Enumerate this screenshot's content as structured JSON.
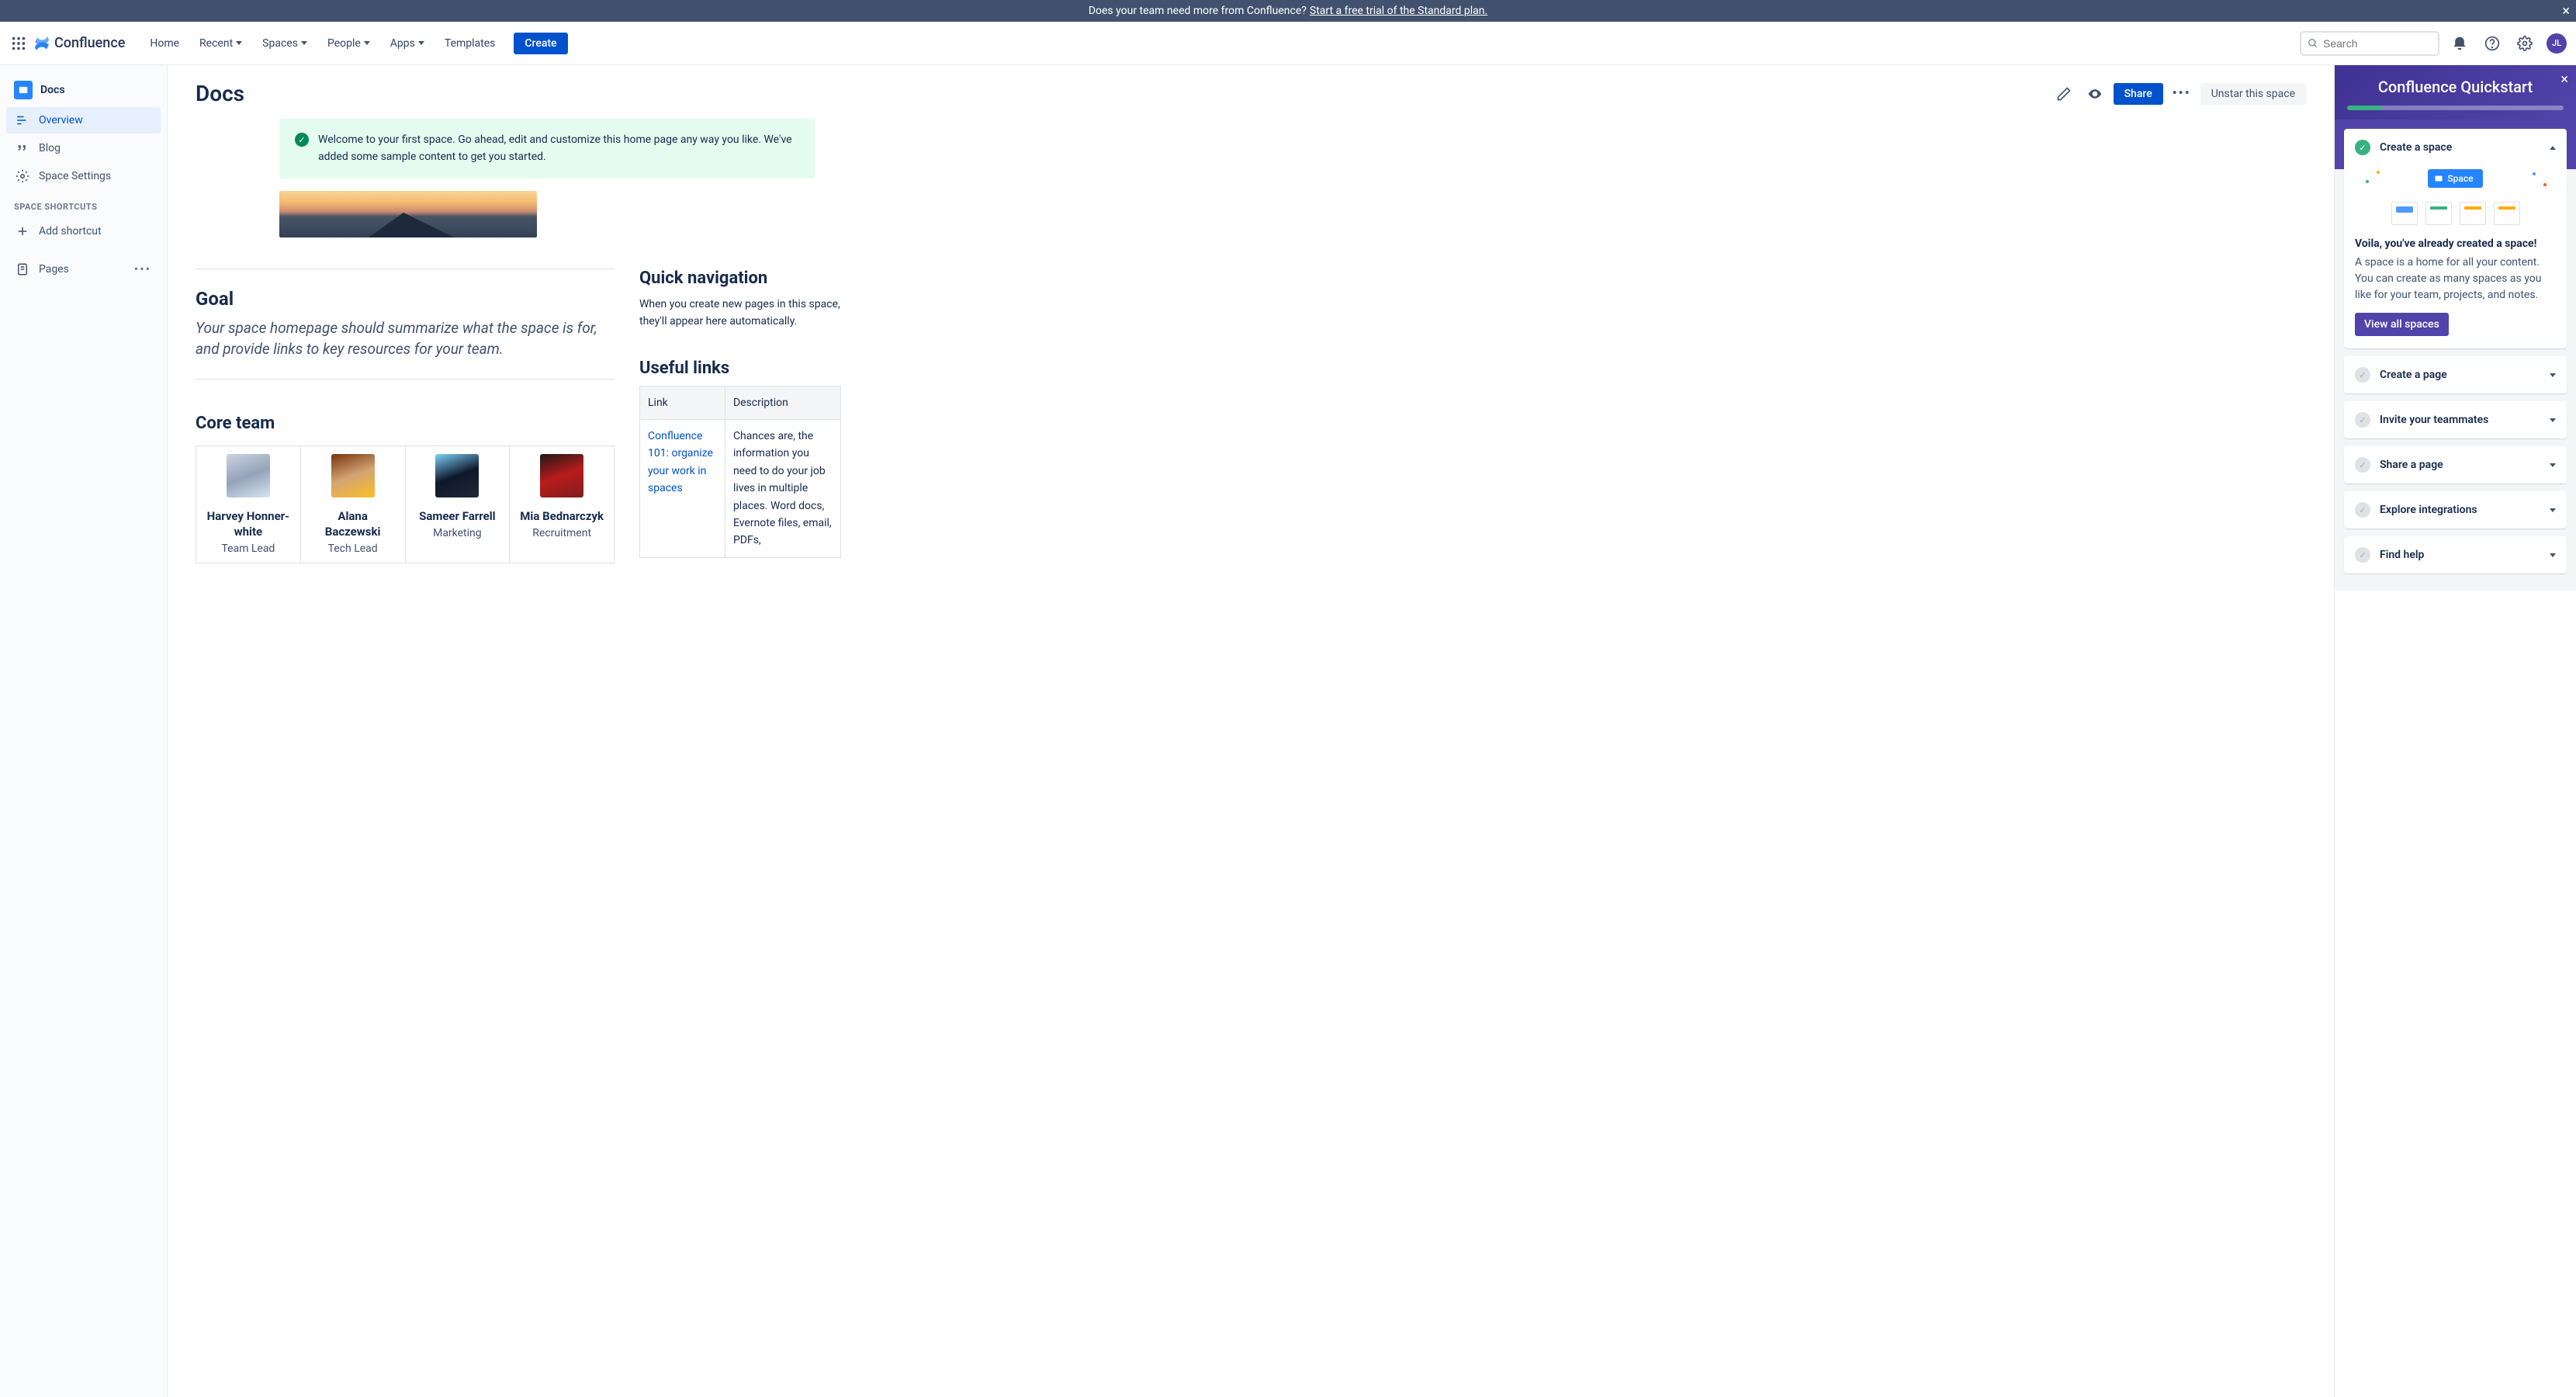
{
  "banner": {
    "text": "Does your team need more from Confluence?",
    "link": "Start a free trial of the Standard plan."
  },
  "header": {
    "product": "Confluence",
    "nav": [
      "Home",
      "Recent",
      "Spaces",
      "People",
      "Apps",
      "Templates"
    ],
    "create": "Create",
    "search_placeholder": "Search",
    "avatar": "JL"
  },
  "sidebar": {
    "space": "Docs",
    "items": [
      {
        "label": "Overview",
        "icon": "overview"
      },
      {
        "label": "Blog",
        "icon": "blog"
      },
      {
        "label": "Space Settings",
        "icon": "settings"
      }
    ],
    "shortcuts_header": "SPACE SHORTCUTS",
    "add_shortcut": "Add shortcut",
    "pages": "Pages"
  },
  "page": {
    "title": "Docs",
    "share": "Share",
    "unstar": "Unstar this space",
    "welcome": "Welcome to your first space. Go ahead, edit and customize this home page any way you like. We've added some sample content to get you started.",
    "goal_heading": "Goal",
    "goal_text": "Your space homepage should summarize what the space is for, and provide links to key resources for your team.",
    "core_team_heading": "Core team",
    "team": [
      {
        "name": "Harvey Honner-white",
        "role": "Team Lead"
      },
      {
        "name": "Alana Baczewski",
        "role": "Tech Lead"
      },
      {
        "name": "Sameer Farrell",
        "role": "Marketing"
      },
      {
        "name": "Mia Bednarczyk",
        "role": "Recruitment"
      }
    ],
    "quick_nav_heading": "Quick navigation",
    "quick_nav_text": "When you create new pages in this space, they'll appear here automatically.",
    "useful_links_heading": "Useful links",
    "links_table": {
      "headers": [
        "Link",
        "Description"
      ],
      "rows": [
        {
          "link": "Confluence 101: organize your work in spaces",
          "desc": "Chances are, the information you need to do your job lives in multiple places. Word docs, Evernote files, email, PDFs,"
        }
      ]
    }
  },
  "quickstart": {
    "title": "Confluence Quickstart",
    "progress_pct": 16,
    "active": {
      "title": "Create a space",
      "badge": "Space",
      "bold": "Voila, you've already created a space!",
      "desc": "A space is a home for all your content. You can create as many spaces as you like for your team, projects, and notes.",
      "button": "View all spaces"
    },
    "steps": [
      "Create a page",
      "Invite your teammates",
      "Share a page",
      "Explore integrations",
      "Find help"
    ]
  }
}
